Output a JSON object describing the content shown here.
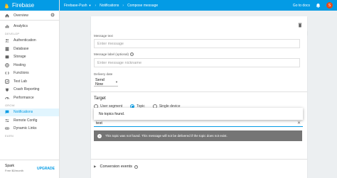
{
  "brand": {
    "title": "Firebase",
    "color": "#039be5"
  },
  "sidebar": {
    "overview": "Overview",
    "items_top": [
      {
        "label": "Analytics",
        "icon": "analytics-icon"
      }
    ],
    "develop_heading": "DEVELOP",
    "develop_items": [
      {
        "label": "Authentication",
        "icon": "people-icon"
      },
      {
        "label": "Database",
        "icon": "database-icon"
      },
      {
        "label": "Storage",
        "icon": "storage-icon"
      },
      {
        "label": "Hosting",
        "icon": "hosting-icon"
      },
      {
        "label": "Functions",
        "icon": "functions-icon"
      },
      {
        "label": "Test Lab",
        "icon": "test-lab-icon"
      },
      {
        "label": "Crash Reporting",
        "icon": "crash-icon"
      },
      {
        "label": "Performance",
        "icon": "performance-icon"
      }
    ],
    "grow_heading": "GROW",
    "grow_items": [
      {
        "label": "Notifications",
        "icon": "chat-icon",
        "active": true
      },
      {
        "label": "Remote Config",
        "icon": "remote-config-icon"
      },
      {
        "label": "Dynamic Links",
        "icon": "link-icon"
      }
    ],
    "earn_heading": "EARN",
    "plan": {
      "name": "Spark",
      "price": "Free $0/month",
      "upgrade": "UPGRADE"
    }
  },
  "topbar": {
    "project": "Firebase-Push",
    "section": "Notifications",
    "page": "Compose message",
    "docs": "Go to docs",
    "avatar_letter": "S"
  },
  "form": {
    "message_text_label": "Message text",
    "message_text_placeholder": "Enter message",
    "message_label_label": "Message label (optional)",
    "message_label_placeholder": "Enter message nickname",
    "delivery_label": "Delivery date",
    "delivery_value": "Send Now",
    "target_heading": "Target",
    "radios": [
      {
        "label": "User segment",
        "checked": false
      },
      {
        "label": "Topic",
        "checked": true
      },
      {
        "label": "Single device",
        "checked": false
      }
    ],
    "dropdown_text": "No topics found.",
    "topic_value": "test",
    "info_text": "This topic was not found. This message will not be delivered if the topic does not exist.",
    "conversion_label": "Conversion events"
  }
}
